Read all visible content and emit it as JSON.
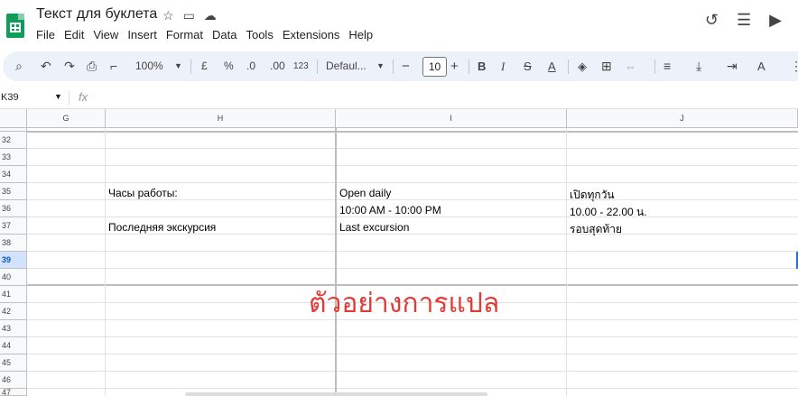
{
  "app": {
    "doc_title": "Текст для буклета",
    "menu": [
      "File",
      "Edit",
      "View",
      "Insert",
      "Format",
      "Data",
      "Tools",
      "Extensions",
      "Help"
    ]
  },
  "toolbar": {
    "zoom": "100%",
    "currency": "£",
    "percent": "%",
    "dec_decrease": ".0",
    "dec_increase": ".00",
    "number_format": "123",
    "font": "Defaul...",
    "font_size": "10"
  },
  "formula_bar": {
    "name_box": "K39",
    "fx": "fx"
  },
  "columns": [
    "G",
    "H",
    "I",
    "J"
  ],
  "rows": [
    "32",
    "33",
    "34",
    "35",
    "36",
    "37",
    "38",
    "39",
    "40",
    "41",
    "42",
    "43",
    "44",
    "45",
    "46",
    "47"
  ],
  "selected_row": "39",
  "cells": {
    "h35": "Часы работы:",
    "i35": "Open daily",
    "j35": "เปิดทุกวัน",
    "i36": "10:00 AM - 10:00 PM",
    "j36": "10.00 - 22.00 น.",
    "h37": "Последняя экскурсия",
    "i37": "Last excursion",
    "j37": "รอบสุดท้าย"
  },
  "overlay_text": "ตัวอย่างการแปล",
  "colors": {
    "sheets_green": "#0f9d58",
    "toolbar_bg": "#edf2fa",
    "selected_row": "#d3e3fd",
    "watermark_red": "#e53935"
  }
}
